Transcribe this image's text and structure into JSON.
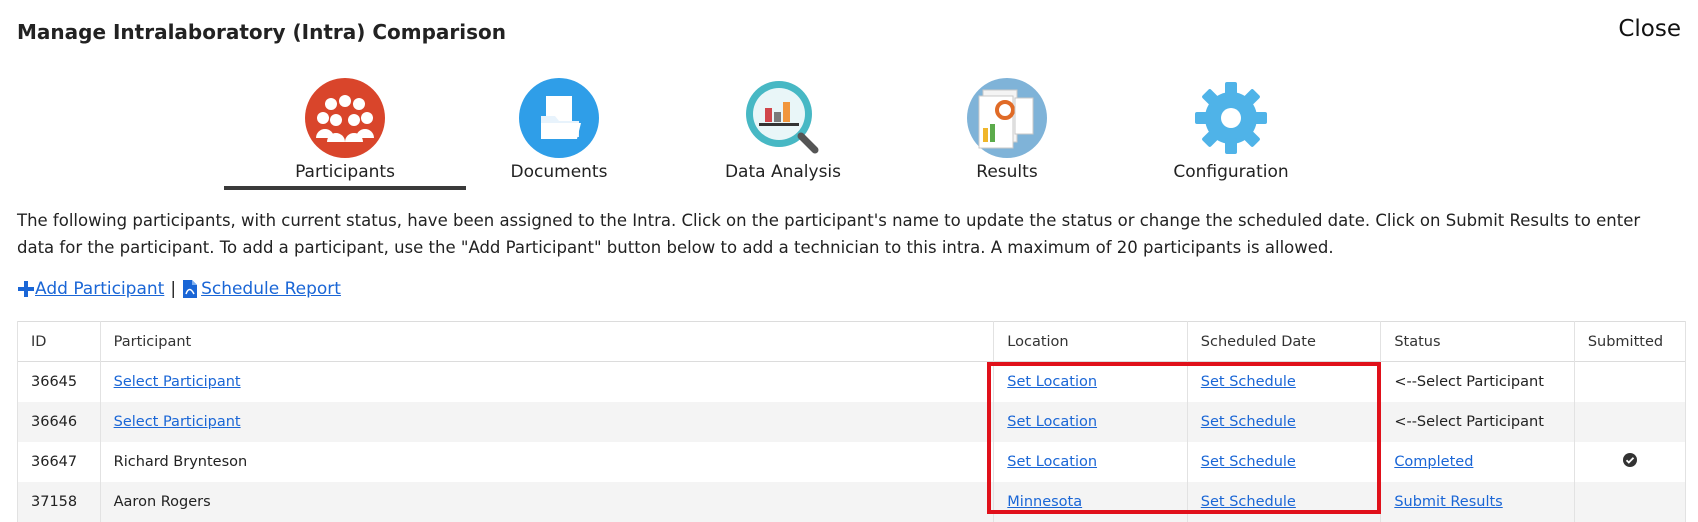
{
  "header": {
    "title": "Manage Intralaboratory (Intra) Comparison",
    "close_label": "Close"
  },
  "tabs": [
    {
      "label": "Participants",
      "icon": "participants-icon",
      "active": true
    },
    {
      "label": "Documents",
      "icon": "documents-icon",
      "active": false
    },
    {
      "label": "Data Analysis",
      "icon": "data-analysis-icon",
      "active": false
    },
    {
      "label": "Results",
      "icon": "results-icon",
      "active": false
    },
    {
      "label": "Configuration",
      "icon": "configuration-gear-icon",
      "active": false
    }
  ],
  "description": "The following participants, with current status, have been assigned to the Intra. Click on the participant's name to update the status or change the scheduled date. Click on Submit Results to enter data for the participant. To add a participant, use the \"Add Participant\" button below to add a technician to this intra. A maximum of 20 participants is allowed.",
  "actions": {
    "add_participant": "Add Participant",
    "separator": "|",
    "schedule_report": "Schedule Report"
  },
  "table": {
    "columns": [
      "ID",
      "Participant",
      "Location",
      "Scheduled Date",
      "Status",
      "Submitted"
    ],
    "rows": [
      {
        "id": "36645",
        "participant": "Select Participant",
        "location": "Set Location",
        "scheduled": "Set Schedule",
        "status": "<--Select Participant",
        "submitted": ""
      },
      {
        "id": "36646",
        "participant": "Select Participant",
        "location": "Set Location",
        "scheduled": "Set Schedule",
        "status": "<--Select Participant",
        "submitted": ""
      },
      {
        "id": "36647",
        "participant": "Richard Brynteson",
        "location": "Set Location",
        "scheduled": "Set Schedule",
        "status": "Completed",
        "submitted": "check-circle-icon"
      },
      {
        "id": "37158",
        "participant": "Aaron Rogers",
        "location": "Minnesota",
        "scheduled": "Set Schedule",
        "status": "Submit Results",
        "submitted": ""
      }
    ]
  },
  "colors": {
    "link": "#1a66d6",
    "highlight_border": "#e0101a",
    "participants_icon_bg": "#d9452b",
    "documents_icon_bg": "#2f9ee8",
    "configuration_gear": "#4fb3e8"
  }
}
